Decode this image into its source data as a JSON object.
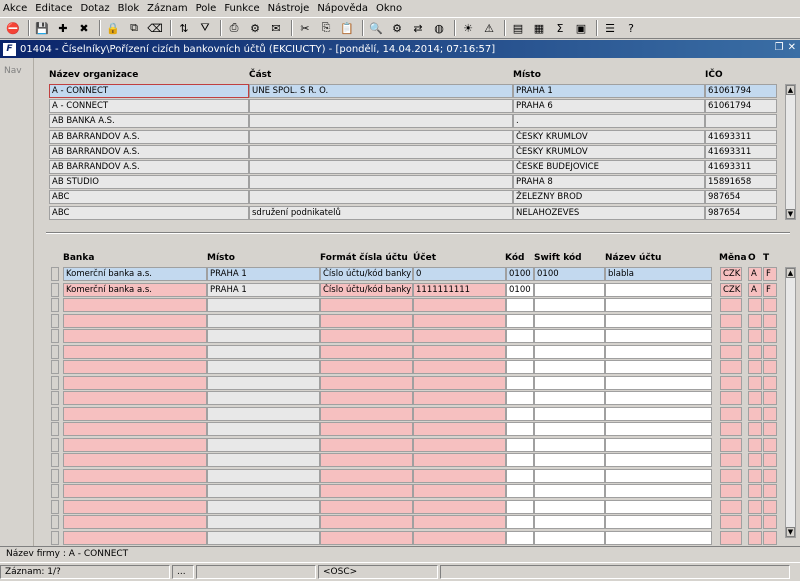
{
  "menu": [
    "Akce",
    "Editace",
    "Dotaz",
    "Blok",
    "Záznam",
    "Pole",
    "Funkce",
    "Nástroje",
    "Nápověda",
    "Okno"
  ],
  "toolbar_icons": [
    "exit-icon",
    "save-icon",
    "insert-record-icon",
    "delete-record-icon",
    "lock-icon",
    "duplicate-icon",
    "clear-icon",
    "sort-icon",
    "filter-icon",
    "print-icon",
    "print-setup-icon",
    "mail-icon",
    "cut-icon",
    "copy-icon",
    "paste-icon",
    "find-icon",
    "settings-icon",
    "transfer-icon",
    "web-icon",
    "sun-icon",
    "warning-icon",
    "report-icon",
    "chart-icon",
    "sum-icon",
    "excel-icon",
    "list-icon",
    "help-icon"
  ],
  "window": {
    "title": "01404 - Číselníky\\Pořízení cizích bankovních účtů (EKCIUCTY) - [pondělí, 14.04.2014; 07:16:57]",
    "app_icon": "F"
  },
  "nav_label": "Nav",
  "top_block": {
    "headers": {
      "org": "Název organizace",
      "cast": "Část",
      "misto": "Místo",
      "ico": "IČO"
    },
    "rows": [
      {
        "org": "A - CONNECT",
        "cast": "UNE SPOL. S R. O.",
        "misto": "PRAHA 1",
        "ico": "61061794"
      },
      {
        "org": "A - CONNECT",
        "cast": "",
        "misto": "PRAHA 6",
        "ico": "61061794"
      },
      {
        "org": "AB BANKA A.S.",
        "cast": "",
        "misto": ".",
        "ico": ""
      },
      {
        "org": "AB BARRANDOV A.S.",
        "cast": "",
        "misto": "ČESKY KRUMLOV",
        "ico": "41693311"
      },
      {
        "org": "AB BARRANDOV A.S.",
        "cast": "",
        "misto": "ČESKY KRUMLOV",
        "ico": "41693311"
      },
      {
        "org": "AB BARRANDOV A.S.",
        "cast": "",
        "misto": "ČESKE BUDEJOVICE",
        "ico": "41693311"
      },
      {
        "org": "AB STUDIO",
        "cast": "",
        "misto": "PRAHA 8",
        "ico": "15891658"
      },
      {
        "org": "ABC",
        "cast": "",
        "misto": "ŽELEZNY BROD",
        "ico": "987654"
      },
      {
        "org": "ABC",
        "cast": "sdružení podnikatelů",
        "misto": "NELAHOZEVES",
        "ico": "987654"
      }
    ]
  },
  "bottom_block": {
    "headers": {
      "banka": "Banka",
      "misto": "Místo",
      "format": "Formát čísla účtu",
      "ucet": "Účet",
      "kod": "Kód",
      "swift": "Swift kód",
      "nazev": "Název účtu",
      "mena": "Měna",
      "o": "O",
      "t": "T"
    },
    "rows": [
      {
        "banka": "Komerční banka a.s.",
        "misto": "PRAHA 1",
        "format": "Číslo účtu/kód banky",
        "ucet": "0",
        "kod": "0100",
        "swift": "0100",
        "nazev": "blabla",
        "mena": "CZK",
        "o": "A",
        "t": "F"
      },
      {
        "banka": "Komerční banka a.s.",
        "misto": "PRAHA 1",
        "format": "Číslo účtu/kód banky",
        "ucet": "1111111111",
        "kod": "0100",
        "swift": "",
        "nazev": "",
        "mena": "CZK",
        "o": "A",
        "t": "F"
      }
    ],
    "empty_rows": 16
  },
  "status": {
    "line1": "Název firmy : A - CONNECT",
    "record": "Záznam: 1/?",
    "ellipsis": "...",
    "osc": "<OSC>"
  }
}
